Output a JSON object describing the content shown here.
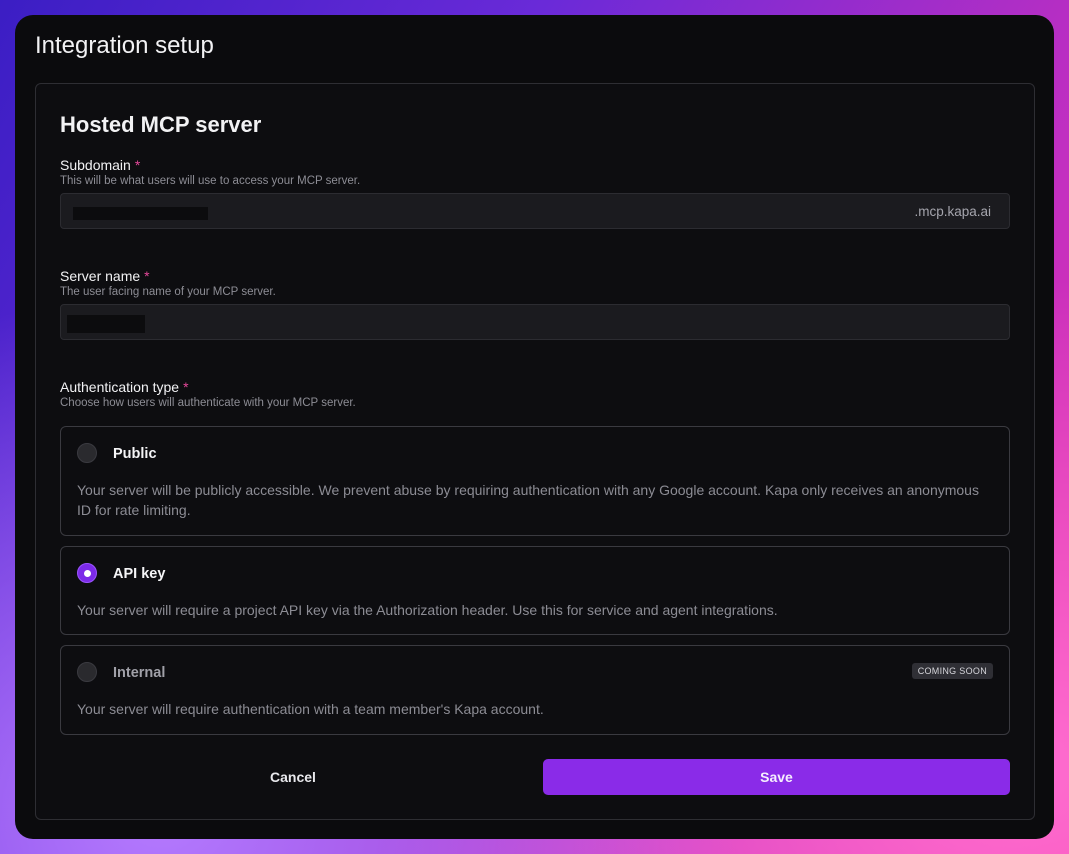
{
  "window": {
    "title": "Integration setup"
  },
  "card": {
    "title": "Hosted MCP server",
    "subdomain": {
      "label": "Subdomain",
      "required_mark": "*",
      "help": "This will be what users will use to access your MCP server.",
      "value": "",
      "suffix": ".mcp.kapa.ai"
    },
    "server_name": {
      "label": "Server name",
      "required_mark": "*",
      "help": "The user facing name of your MCP server.",
      "value": ""
    },
    "auth": {
      "label": "Authentication type",
      "required_mark": "*",
      "help": "Choose how users will authenticate with your MCP server.",
      "selected": "API key",
      "options": [
        {
          "title": "Public",
          "description": "Your server will be publicly accessible. We prevent abuse by requiring authentication with any Google account. Kapa only receives an anonymous ID for rate limiting."
        },
        {
          "title": "API key",
          "description": "Your server will require a project API key via the Authorization header. Use this for service and agent integrations."
        },
        {
          "title": "Internal",
          "description": "Your server will require authentication with a team member's Kapa account.",
          "badge": "COMING SOON"
        }
      ]
    },
    "actions": {
      "cancel": "Cancel",
      "save": "Save"
    }
  },
  "colors": {
    "accent": "#8a2be8",
    "required": "#e6489b",
    "background": "#0b0b0d"
  }
}
